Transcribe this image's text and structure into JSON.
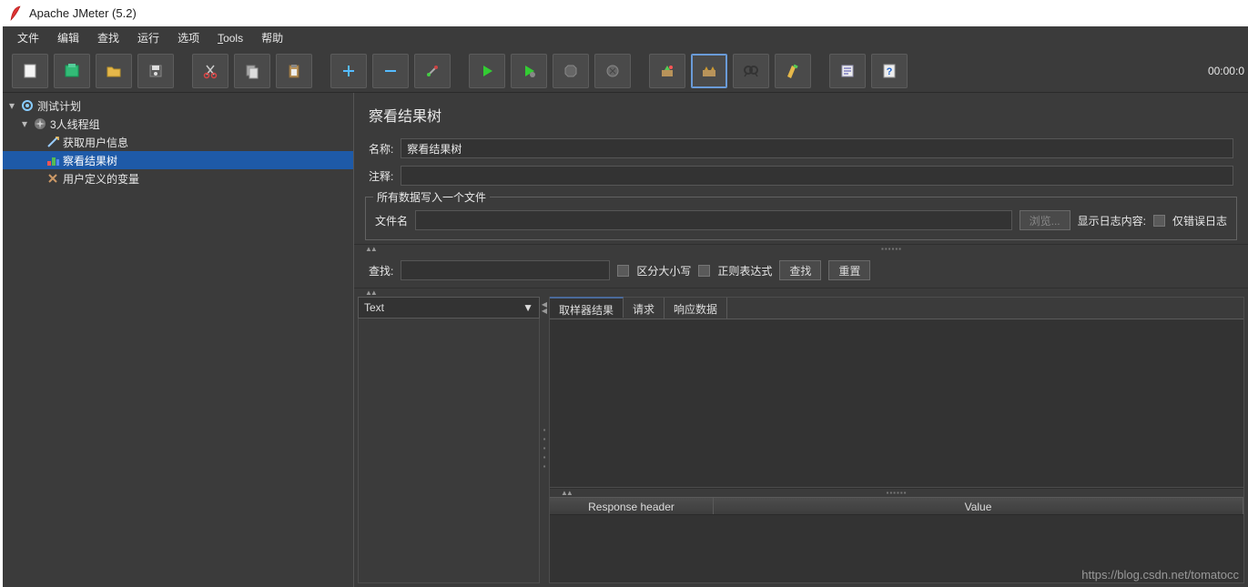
{
  "window": {
    "title": "Apache JMeter (5.2)"
  },
  "menu": {
    "file": "文件",
    "edit": "编辑",
    "search": "查找",
    "run": "运行",
    "options": "选项",
    "tools": "Tools",
    "help": "帮助"
  },
  "timer": "00:00:0",
  "tree": {
    "root": {
      "label": "测试计划"
    },
    "group": {
      "label": "3人线程组"
    },
    "items": [
      {
        "label": "获取用户信息"
      },
      {
        "label": "察看结果树"
      },
      {
        "label": "用户定义的变量"
      }
    ]
  },
  "editor": {
    "title": "察看结果树",
    "name_label": "名称:",
    "name_value": "察看结果树",
    "comment_label": "注释:",
    "comment_value": "",
    "file_group": "所有数据写入一个文件",
    "filename_label": "文件名",
    "filename_value": "",
    "browse": "浏览...",
    "show_log_label": "显示日志内容:",
    "errors_only": "仅错误日志"
  },
  "search": {
    "label": "查找:",
    "value": "",
    "case_sensitive": "区分大小写",
    "regex": "正则表达式",
    "find_btn": "查找",
    "reset_btn": "重置"
  },
  "results": {
    "render_type": "Text",
    "tabs": {
      "sampler": "取样器结果",
      "request": "请求",
      "response": "响应数据"
    },
    "table_headers": {
      "header": "Response header",
      "value": "Value"
    }
  },
  "watermark": "https://blog.csdn.net/tomatocc"
}
